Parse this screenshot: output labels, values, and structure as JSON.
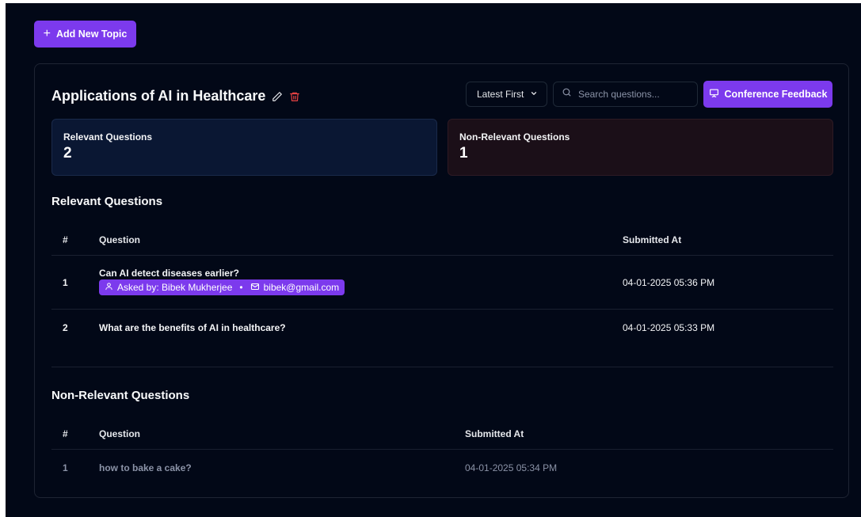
{
  "toolbar": {
    "add_label": "Add New Topic"
  },
  "topic": {
    "title": "Applications of AI in Healthcare"
  },
  "controls": {
    "sort_selected": "Latest First",
    "search_placeholder": "Search questions...",
    "feedback_label": "Conference Feedback"
  },
  "stats": {
    "relevant": {
      "label": "Relevant Questions",
      "value": "2"
    },
    "non_relevant": {
      "label": "Non-Relevant Questions",
      "value": "1"
    }
  },
  "relevant": {
    "title": "Relevant Questions",
    "headers": {
      "num": "#",
      "question": "Question",
      "submitted": "Submitted At"
    },
    "rows": [
      {
        "num": "1",
        "question": "Can AI detect diseases earlier?",
        "asked_by": "Asked by: Bibek Mukherjee",
        "separator": "•",
        "email": "bibek@gmail.com",
        "submitted": "04-01-2025 05:36 PM"
      },
      {
        "num": "2",
        "question": "What are the benefits of AI in healthcare?",
        "submitted": "04-01-2025 05:33 PM"
      }
    ]
  },
  "non_relevant": {
    "title": "Non-Relevant Questions",
    "headers": {
      "num": "#",
      "question": "Question",
      "submitted": "Submitted At"
    },
    "rows": [
      {
        "num": "1",
        "question": "how to bake a cake?",
        "submitted": "04-01-2025 05:34 PM"
      }
    ]
  },
  "colors": {
    "accent": "#7c3aed",
    "danger": "#ef4444",
    "background": "#020817"
  },
  "icons": [
    "plus-icon",
    "pencil-icon",
    "trash-icon",
    "chevron-down-icon",
    "search-icon",
    "presentation-icon",
    "user-icon",
    "mail-icon"
  ]
}
